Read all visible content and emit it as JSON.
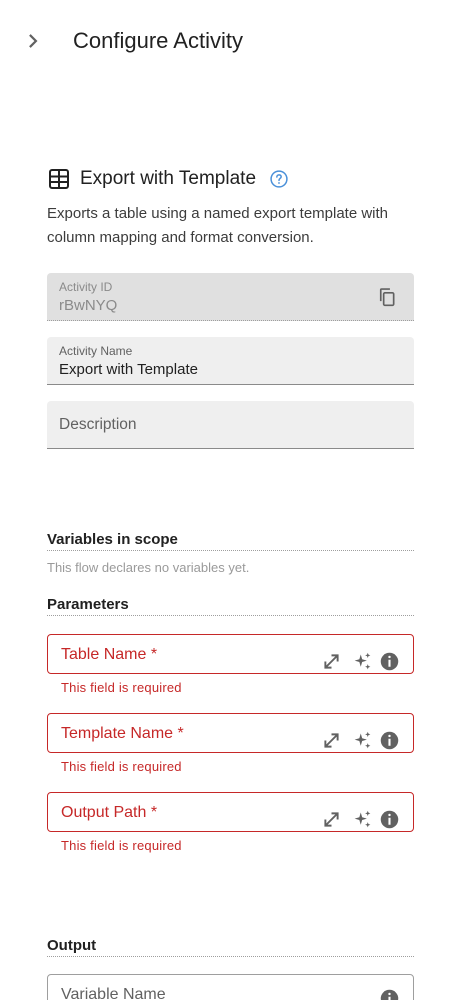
{
  "header": {
    "title": "Configure Activity",
    "collapse_icon": "chevron-right-icon"
  },
  "activity": {
    "icon": "table-icon",
    "title": "Export with Template",
    "help_icon": "help-circle-icon",
    "description": "Exports a table using a named export template with column mapping and format conversion."
  },
  "fields": {
    "activity_id": {
      "label": "Activity ID",
      "value": "rBwNYQ",
      "copy_icon": "copy-icon"
    },
    "activity_name": {
      "label": "Activity Name",
      "value": "Export with Template"
    },
    "description": {
      "placeholder": "Description"
    }
  },
  "variables": {
    "heading": "Variables in scope",
    "empty_text": "This flow declares no variables yet."
  },
  "parameters": {
    "heading": "Parameters",
    "items": [
      {
        "label": "Table Name *",
        "error": "This field is required"
      },
      {
        "label": "Template Name *",
        "error": "This field is required"
      },
      {
        "label": "Output Path *",
        "error": "This field is required"
      }
    ],
    "icons": [
      "expand-icon",
      "sparkle-icon",
      "info-icon"
    ]
  },
  "output": {
    "heading": "Output",
    "placeholder": "Variable Name"
  },
  "colors": {
    "error": "#c62828",
    "help": "#4a90d9",
    "field_bg": "#efefef",
    "disabled_bg": "#e0e0e0"
  }
}
